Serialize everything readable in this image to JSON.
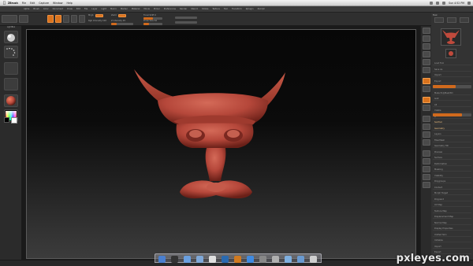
{
  "menubar": {
    "apple_icon": "apple-icon",
    "app_name": "ZBrush",
    "items": [
      "File",
      "Edit",
      "Capture",
      "Window",
      "Help"
    ],
    "clock": "Sun 4:52 PM"
  },
  "zbrush_menus": [
    "Alpha",
    "Brush",
    "Color",
    "Document",
    "Draw",
    "Edit",
    "File",
    "Layer",
    "Light",
    "Macro",
    "Marker",
    "Material",
    "Movie",
    "Picker",
    "Preferences",
    "Render",
    "Stencil",
    "Stroke",
    "Texture",
    "Tool",
    "Transform",
    "Zplugin",
    "Zscript"
  ],
  "toolbar": {
    "draw_label": "Draw",
    "move_label": "Move",
    "scale_label": "Scale",
    "rotate_label": "Rotate",
    "mrgb_label": "Mrgb",
    "rgb_label": "Rgb",
    "m_label": "M",
    "zadd_label": "Zadd",
    "zsub_label": "Zsub",
    "focal_label": "Focal Shift 0",
    "drawsize_label": "Draw Size 64",
    "zintensity_label": "Z Intensity 25",
    "rgb_intensity_label": "Rgb Intensity 100",
    "focal_value": 0.5,
    "drawsize_value": 0.3,
    "zintensity_value": 0.25
  },
  "left_shelf": {
    "lightbox_label": "LightBox",
    "brush_icon": "brush-sphere-icon",
    "stroke_icon": "stroke-dots-icon",
    "alpha_icon": "alpha-icon",
    "texture_icon": "texture-icon",
    "material_icon": "material-sphere-icon",
    "color_picker_icon": "color-picker-icon"
  },
  "right_tray": {
    "tool_title": "Tool",
    "rows": [
      "Load Tool",
      "Save As",
      "Import",
      "Export",
      "Clone",
      "Make PolyMesh3D",
      "GoZ",
      "All",
      "Visible",
      "R",
      "SubTool",
      "Geometry",
      "Layers",
      "FiberMesh",
      "Geometry HD",
      "Preview",
      "Surface",
      "Deformation",
      "Masking",
      "Visibility",
      "Polygroups",
      "Contact",
      "Morph Target",
      "Polypaint",
      "UV Map",
      "Texture Map",
      "Displacement Map",
      "Normal Map",
      "Display Properties",
      "Unified Skin",
      "Initialize",
      "Import",
      "Export"
    ],
    "highlight_rows": [
      10,
      11
    ],
    "slider_value": 0.6,
    "subdiv_value": 0.75
  },
  "canvas": {
    "subject_icon": "horned-head-sculpt-icon",
    "sculpt_color": "#b5473a",
    "background_top": "#070707",
    "background_bottom": "#3c3c3c"
  },
  "dock": {
    "icons": [
      "finder-icon",
      "dashboard-icon",
      "safari-icon",
      "mail-icon",
      "ical-icon",
      "photoshop-icon",
      "illustrator-icon",
      "itunes-icon",
      "preferences-icon",
      "zbrush-icon",
      "folder-icon",
      "downloads-icon",
      "trash-icon"
    ],
    "colors": [
      "#4a7fcf",
      "#333333",
      "#6aa0e0",
      "#7fa8d8",
      "#e0e0e0",
      "#2a6ab0",
      "#d07a20",
      "#3f8ae0",
      "#888888",
      "#b0b0b0",
      "#7fb0e0",
      "#6a9ad0",
      "#cfcfcf"
    ]
  },
  "watermark": "pxleyes.com",
  "colors": {
    "accent_orange": "#d9731e",
    "ui_panel": "#333333"
  }
}
